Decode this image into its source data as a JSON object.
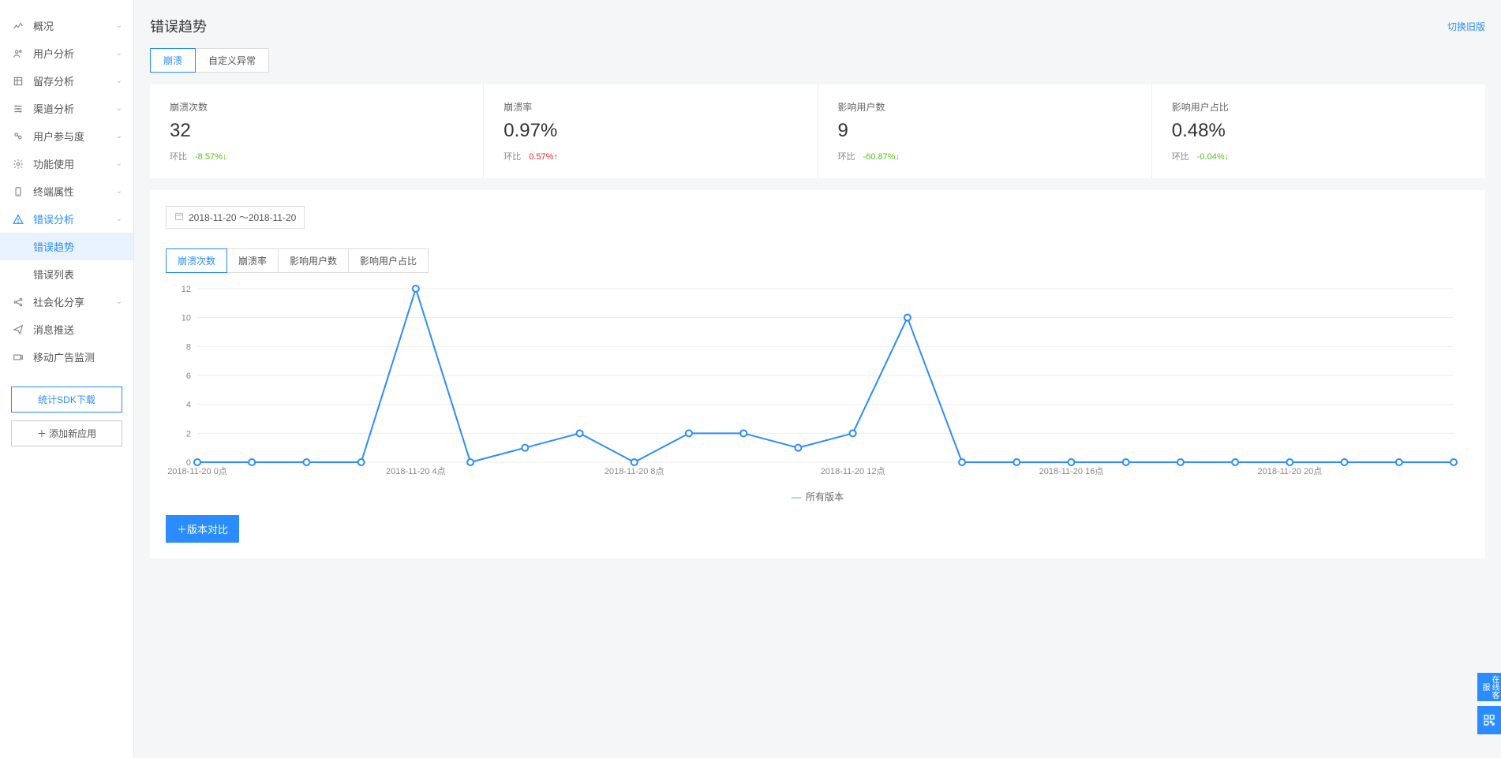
{
  "sidebar": {
    "items": [
      {
        "label": "概况",
        "icon": "chart"
      },
      {
        "label": "用户分析",
        "icon": "users"
      },
      {
        "label": "留存分析",
        "icon": "retain"
      },
      {
        "label": "渠道分析",
        "icon": "channel"
      },
      {
        "label": "用户参与度",
        "icon": "engage"
      },
      {
        "label": "功能使用",
        "icon": "gear"
      },
      {
        "label": "终端属性",
        "icon": "device"
      },
      {
        "label": "错误分析",
        "icon": "warn",
        "active": true
      },
      {
        "label": "社会化分享",
        "icon": "share"
      },
      {
        "label": "消息推送",
        "icon": "send"
      },
      {
        "label": "移动广告监测",
        "icon": "ad"
      }
    ],
    "sub_items": [
      {
        "label": "错误趋势",
        "active": true
      },
      {
        "label": "错误列表"
      }
    ],
    "sdk_btn": "统计SDK下载",
    "add_app_btn": "添加新应用"
  },
  "page": {
    "title": "错误趋势",
    "old_link": "切换旧版"
  },
  "type_tabs": [
    {
      "label": "崩溃",
      "active": true
    },
    {
      "label": "自定义异常"
    }
  ],
  "stats": [
    {
      "label": "崩溃次数",
      "value": "32",
      "ratio_label": "环比",
      "pct": "-8.57%",
      "dir": "down"
    },
    {
      "label": "崩溃率",
      "value": "0.97%",
      "ratio_label": "环比",
      "pct": "0.57%",
      "dir": "up"
    },
    {
      "label": "影响用户数",
      "value": "9",
      "ratio_label": "环比",
      "pct": "-60.87%",
      "dir": "down"
    },
    {
      "label": "影响用户占比",
      "value": "0.48%",
      "ratio_label": "环比",
      "pct": "-0.04%",
      "dir": "down"
    }
  ],
  "date_range": "2018-11-20 ～2018-11-20",
  "chart_tabs": [
    {
      "label": "崩溃次数",
      "active": true
    },
    {
      "label": "崩溃率"
    },
    {
      "label": "影响用户数"
    },
    {
      "label": "影响用户占比"
    }
  ],
  "legend": "所有版本",
  "compare_btn": "版本对比",
  "float": {
    "chat": "在线客服"
  },
  "chart_data": {
    "type": "line",
    "title": "",
    "xlabel": "",
    "ylabel": "",
    "ylim": [
      0,
      12
    ],
    "y_ticks": [
      0,
      2,
      4,
      6,
      8,
      10,
      12
    ],
    "x_tick_labels": [
      "2018-11-20 0点",
      "2018-11-20 4点",
      "2018-11-20 8点",
      "2018-11-20 12点",
      "2018-11-20 16点",
      "2018-11-20 20点"
    ],
    "categories": [
      "0",
      "1",
      "2",
      "3",
      "4",
      "5",
      "6",
      "7",
      "8",
      "9",
      "10",
      "11",
      "12",
      "13",
      "14",
      "15",
      "16",
      "17",
      "18",
      "19",
      "20",
      "21",
      "22",
      "23"
    ],
    "series": [
      {
        "name": "所有版本",
        "values": [
          0,
          0,
          0,
          0,
          12,
          0,
          1,
          2,
          0,
          2,
          2,
          1,
          2,
          10,
          0,
          0,
          0,
          0,
          0,
          0,
          0,
          0,
          0,
          0
        ]
      }
    ]
  }
}
